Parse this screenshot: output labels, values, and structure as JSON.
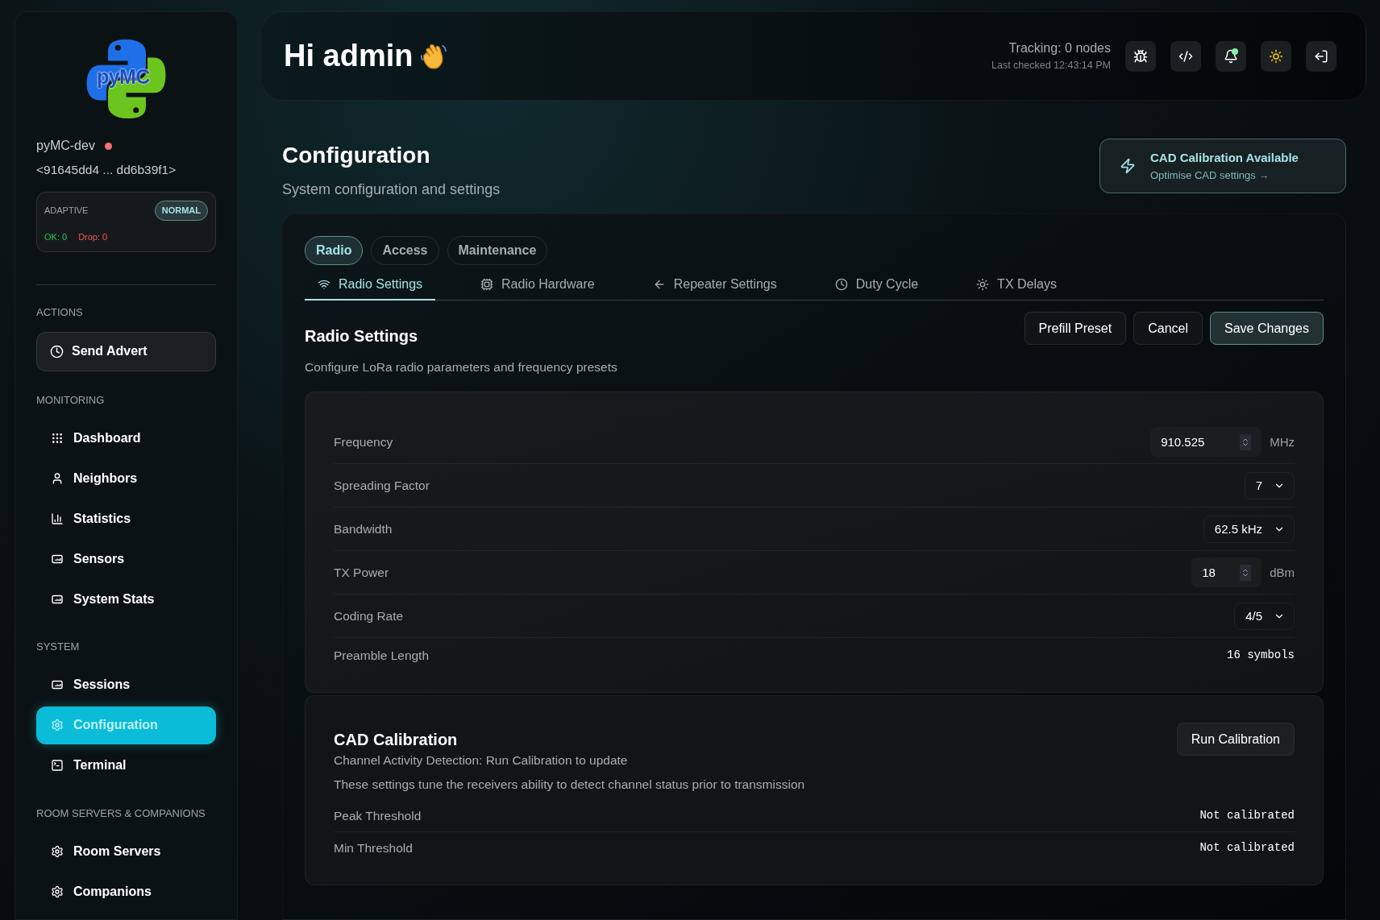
{
  "sidebar": {
    "logo_text": "pyMC",
    "node_name": "pyMC-dev",
    "status_dot": {
      "color": "#f87171"
    },
    "node_key": "<91645dd4 ... dd6b39f1>",
    "mode": {
      "label": "ADAPTIVE",
      "badge": "NORMAL",
      "ok": "OK: 0",
      "drop": "Drop: 0"
    },
    "sections": [
      {
        "title": "ACTIONS",
        "items": [
          {
            "label": "Send Advert",
            "kind": "action",
            "selected": false
          }
        ]
      },
      {
        "title": "MONITORING",
        "items": [
          {
            "label": "Dashboard",
            "kind": "nav",
            "selected": false
          },
          {
            "label": "Neighbors",
            "kind": "nav",
            "selected": false
          },
          {
            "label": "Statistics",
            "kind": "nav",
            "selected": false
          },
          {
            "label": "Sensors",
            "kind": "nav",
            "selected": false
          },
          {
            "label": "System Stats",
            "kind": "nav",
            "selected": false
          }
        ]
      },
      {
        "title": "SYSTEM",
        "items": [
          {
            "label": "Sessions",
            "kind": "nav",
            "selected": false
          },
          {
            "label": "Configuration",
            "kind": "nav",
            "selected": true
          },
          {
            "label": "Terminal",
            "kind": "nav",
            "selected": false
          }
        ]
      },
      {
        "title": "ROOM SERVERS & COMPANIONS",
        "items": [
          {
            "label": "Room Servers",
            "kind": "nav",
            "selected": false
          },
          {
            "label": "Companions",
            "kind": "nav",
            "selected": false
          }
        ]
      }
    ]
  },
  "header": {
    "greeting": "Hi admin",
    "tracking": "Tracking: 0 nodes",
    "last_checked": "Last checked 12:43:14 PM",
    "notifications_unread": true
  },
  "page": {
    "title": "Configuration",
    "subtitle": "System configuration and settings",
    "banner": {
      "title": "CAD Calibration Available",
      "link": "Optimise CAD settings →"
    }
  },
  "tabs": [
    {
      "label": "Radio",
      "selected": true
    },
    {
      "label": "Access",
      "selected": false
    },
    {
      "label": "Maintenance",
      "selected": false
    }
  ],
  "subtabs": [
    {
      "label": "Radio Settings",
      "selected": true
    },
    {
      "label": "Radio Hardware",
      "selected": false
    },
    {
      "label": "Repeater Settings",
      "selected": false
    },
    {
      "label": "Duty Cycle",
      "selected": false
    },
    {
      "label": "TX Delays",
      "selected": false
    }
  ],
  "section": {
    "title": "Radio Settings",
    "description": "Configure LoRa radio parameters and frequency presets",
    "buttons": [
      {
        "label": "Prefill Preset",
        "kind": "default"
      },
      {
        "label": "Cancel",
        "kind": "default"
      },
      {
        "label": "Save Changes",
        "kind": "primary"
      }
    ]
  },
  "fields": [
    {
      "label": "Frequency",
      "kind": "number",
      "value": "910.525",
      "unit": "MHz"
    },
    {
      "label": "Spreading Factor",
      "kind": "select",
      "value": "7"
    },
    {
      "label": "Bandwidth",
      "kind": "select",
      "value": "62.5 kHz"
    },
    {
      "label": "TX Power",
      "kind": "number",
      "value": "18",
      "unit": "dBm"
    },
    {
      "label": "Coding Rate",
      "kind": "select",
      "value": "4/5"
    },
    {
      "label": "Preamble Length",
      "kind": "text",
      "value": "16 symbols"
    }
  ],
  "cad": {
    "title": "CAD Calibration",
    "button": "Run Calibration",
    "lines": [
      "Channel Activity Detection: Run Calibration to update",
      "These settings tune the receivers ability to detect channel status prior to transmission"
    ],
    "readings": [
      {
        "label": "Peak Threshold",
        "value": "Not calibrated"
      },
      {
        "label": "Min Threshold",
        "value": "Not calibrated"
      }
    ]
  }
}
